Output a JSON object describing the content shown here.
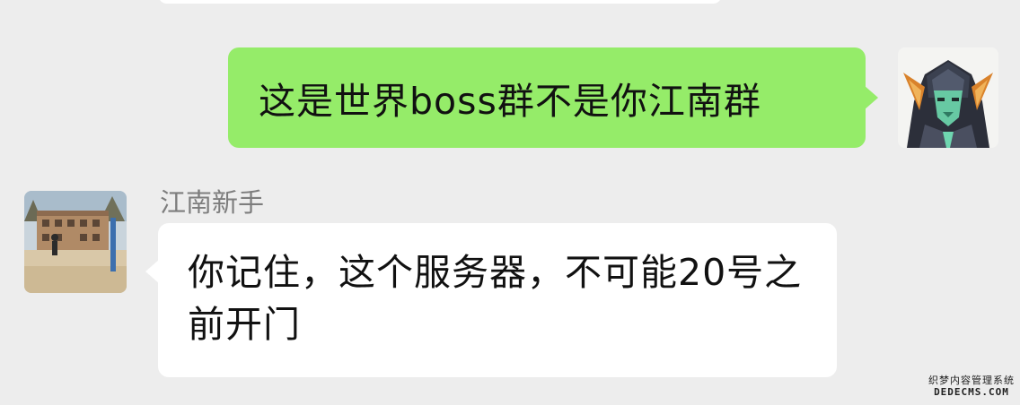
{
  "conversation": {
    "outgoing_message": {
      "text": "这是世界boss群不是你江南群",
      "bubble_color": "#95ec69"
    },
    "incoming_message": {
      "sender_name": "江南新手",
      "text": "你记住，这个服务器，不可能20号之前开门",
      "bubble_color": "#ffffff"
    }
  },
  "watermark": {
    "line1": "织梦内容管理系统",
    "line2": "DEDECMS.COM"
  },
  "icons": {
    "outgoing_avatar": "armored-character-avatar-icon",
    "incoming_avatar": "playground-photo-avatar-icon"
  }
}
